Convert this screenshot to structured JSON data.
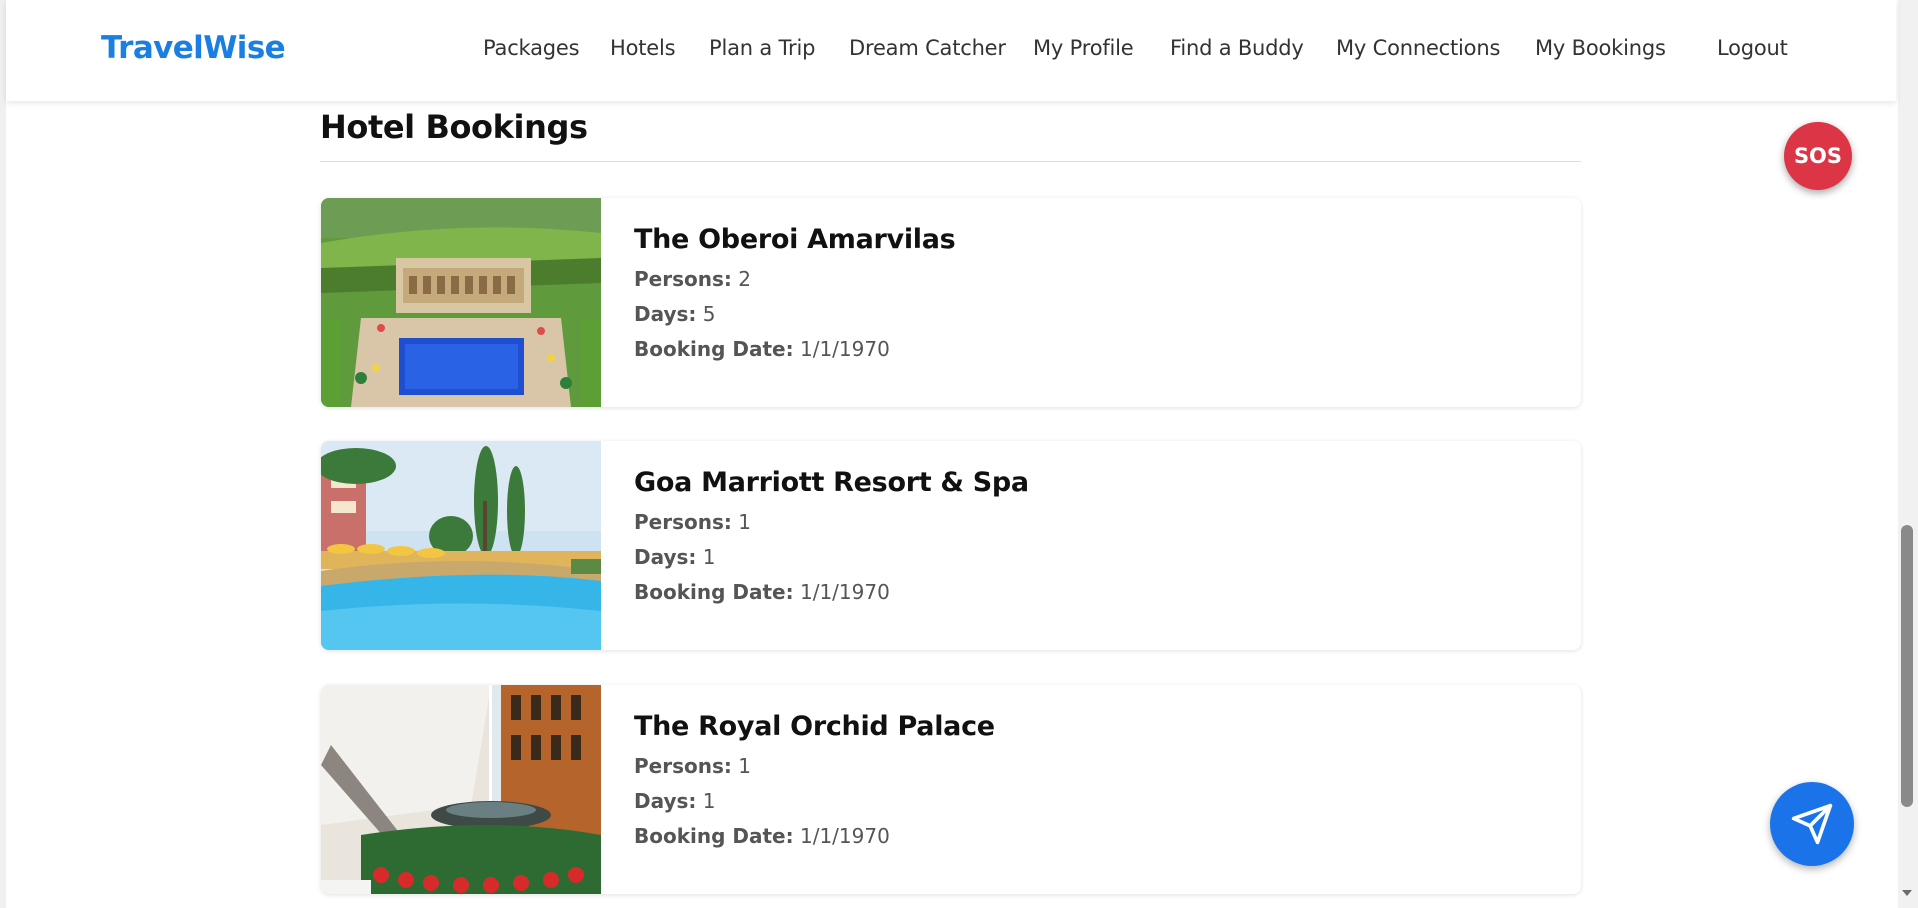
{
  "navbar": {
    "brand": "TravelWise",
    "links": [
      "Packages",
      "Hotels",
      "Plan a Trip",
      "Dream Catcher",
      "My Profile",
      "Find a Buddy",
      "My Connections",
      "My Bookings",
      "Logout"
    ]
  },
  "section": {
    "title": "Hotel Bookings"
  },
  "labels": {
    "persons": "Persons:",
    "days": "Days:",
    "booking_date": "Booking Date:"
  },
  "bookings": [
    {
      "name": "The Oberoi Amarvilas",
      "persons": "2",
      "days": "5",
      "booking_date": "1/1/1970"
    },
    {
      "name": "Goa Marriott Resort & Spa",
      "persons": "1",
      "days": "1",
      "booking_date": "1/1/1970"
    },
    {
      "name": "The Royal Orchid Palace",
      "persons": "1",
      "days": "1",
      "booking_date": "1/1/1970"
    }
  ],
  "sos": {
    "label": "SOS"
  },
  "icons": {
    "fab": "send-icon"
  },
  "colors": {
    "brand": "#1a7fe0",
    "sos": "#dc3545",
    "fab": "#1a73e8"
  }
}
